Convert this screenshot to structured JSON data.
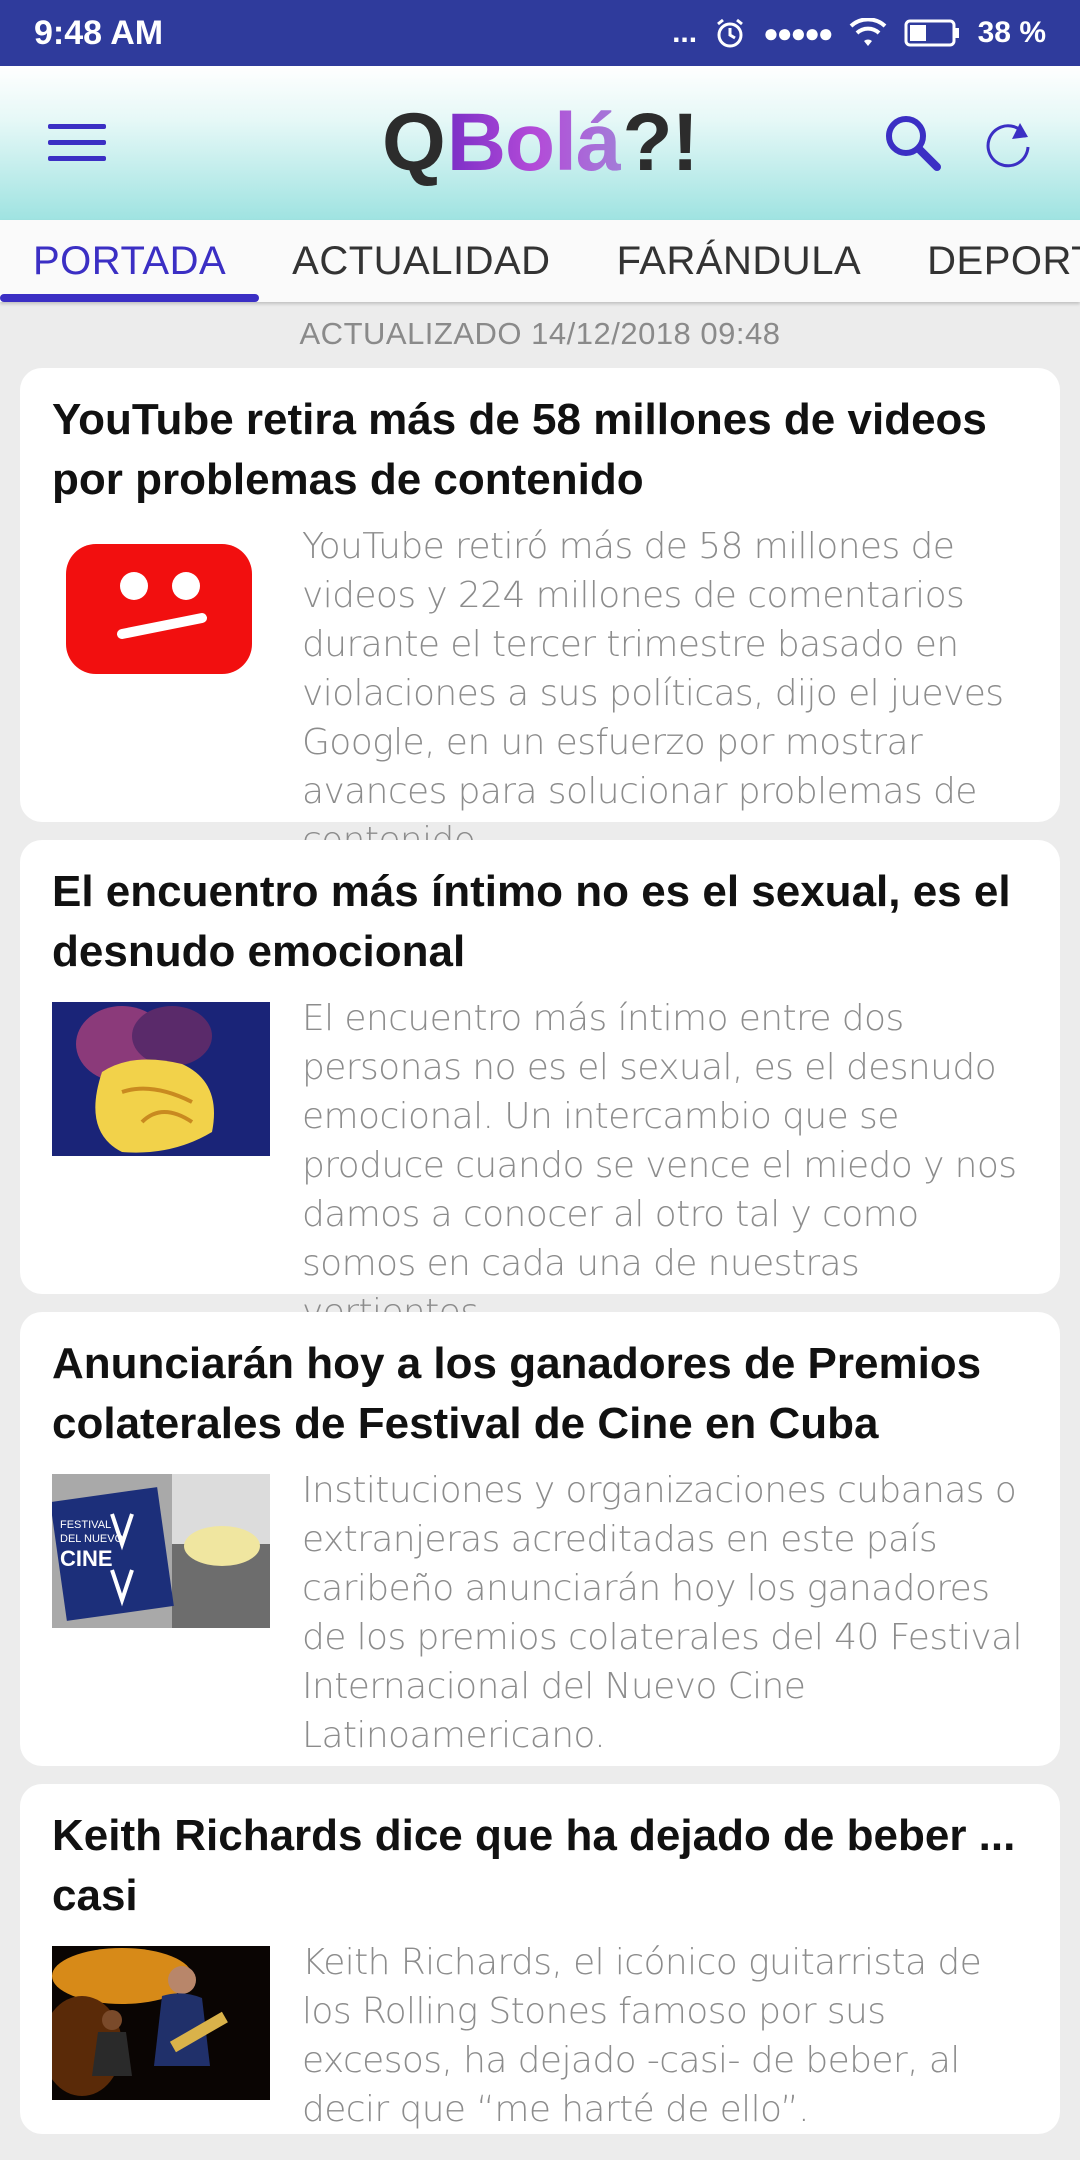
{
  "status_bar": {
    "time": "9:48 AM",
    "dots": "...",
    "signal": "●●●●●",
    "battery": "38 %"
  },
  "app_bar": {
    "logo": {
      "q": "Q",
      "bola": "Bolá",
      "qm": "?!"
    },
    "icons": [
      "menu-icon",
      "search-icon",
      "refresh-icon"
    ],
    "accent_color": "#3b2fc4"
  },
  "tabs": [
    {
      "label": "PORTADA",
      "active": true
    },
    {
      "label": "ACTUALIDAD",
      "active": false
    },
    {
      "label": "FARÁNDULA",
      "active": false
    },
    {
      "label": "DEPORTES",
      "active": false
    }
  ],
  "updated": "ACTUALIZADO 14/12/2018 09:48",
  "articles": [
    {
      "title": "YouTube retira más de 58 millones de videos por problemas de contenido",
      "summary": "YouTube retiró más de 58 millones de videos y 224 millones de comentarios durante el tercer trimestre basado en vio­laciones a sus políticas, dijo el jueves Goo­gle, en un esfuerzo por mostrar avances para solucionar problemas de contenido."
    },
    {
      "title": "El encuentro más íntimo no es el sexual, es el desnudo emocional",
      "summary": "El encuentro más íntimo entre dos personas no es el sexual, es el desnudo emocional. Un intercambio que se produce cuando se vence el miedo y nos damos a conocer al otro tal y como somos en cada una de nuestras vertientes."
    },
    {
      "title": "Anunciarán hoy a los ganadores de Premios colaterales de Festival de Cine en Cuba",
      "summary": "Instituciones y organizaciones cubanas o extranjeras acreditadas en este país caribeño anunciarán hoy los ganadores de los premios colaterales del 40 Festival Internacional del Nuevo Cine Latinoamericano.",
      "thumb_text": {
        "line1": "FESTIVAL",
        "line2": "DEL NUEVO",
        "line3": "CINE"
      }
    },
    {
      "title": "Keith Richards dice que ha dejado de beber ... casi",
      "summary": "Keith Richards, el icónico guitarrista de los Rolling Stones famoso por sus excesos, ha dejado -casi- de beber, al decir que “me harté de ello”."
    }
  ]
}
